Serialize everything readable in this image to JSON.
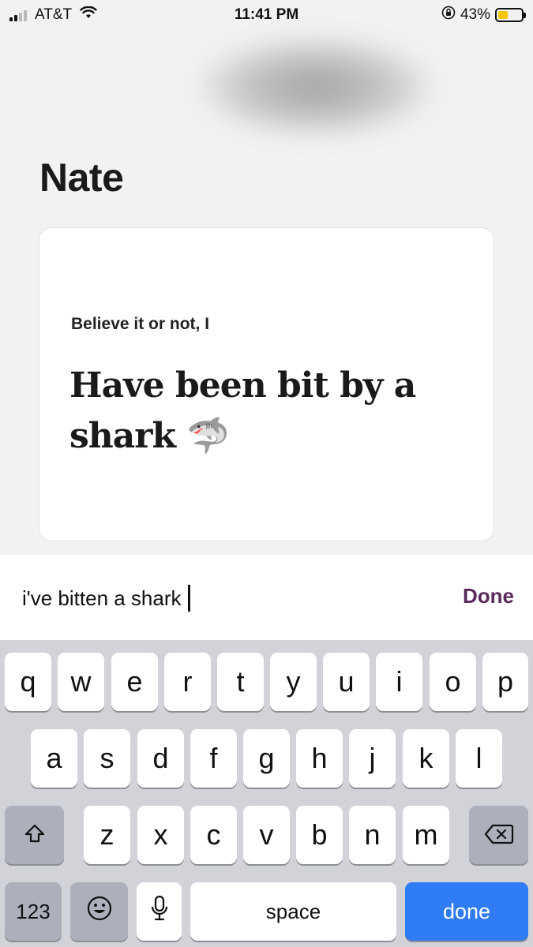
{
  "status_bar": {
    "carrier": "AT&T",
    "time": "11:41 PM",
    "battery_percent": "43%",
    "battery_level": 0.43,
    "signal_bars_active": 2,
    "icons": [
      "signal-icon",
      "wifi-icon",
      "orientation-lock-icon",
      "battery-icon"
    ]
  },
  "profile": {
    "name": "Nate"
  },
  "prompt_card": {
    "question": "Believe it or not, I",
    "answer": "Have been bit by a shark 🦈"
  },
  "input_bar": {
    "value": "i've bitten a shark",
    "done_label": "Done",
    "done_color": "#5a2a5a"
  },
  "keyboard": {
    "row1": [
      "q",
      "w",
      "e",
      "r",
      "t",
      "y",
      "u",
      "i",
      "o",
      "p"
    ],
    "row2": [
      "a",
      "s",
      "d",
      "f",
      "g",
      "h",
      "j",
      "k",
      "l"
    ],
    "row3": [
      "z",
      "x",
      "c",
      "v",
      "b",
      "n",
      "m"
    ],
    "numbers_label": "123",
    "space_label": "space",
    "return_label": "done",
    "return_color": "#2f7cf6",
    "icons": [
      "shift-icon",
      "backspace-icon",
      "emoji-icon",
      "microphone-icon"
    ]
  }
}
